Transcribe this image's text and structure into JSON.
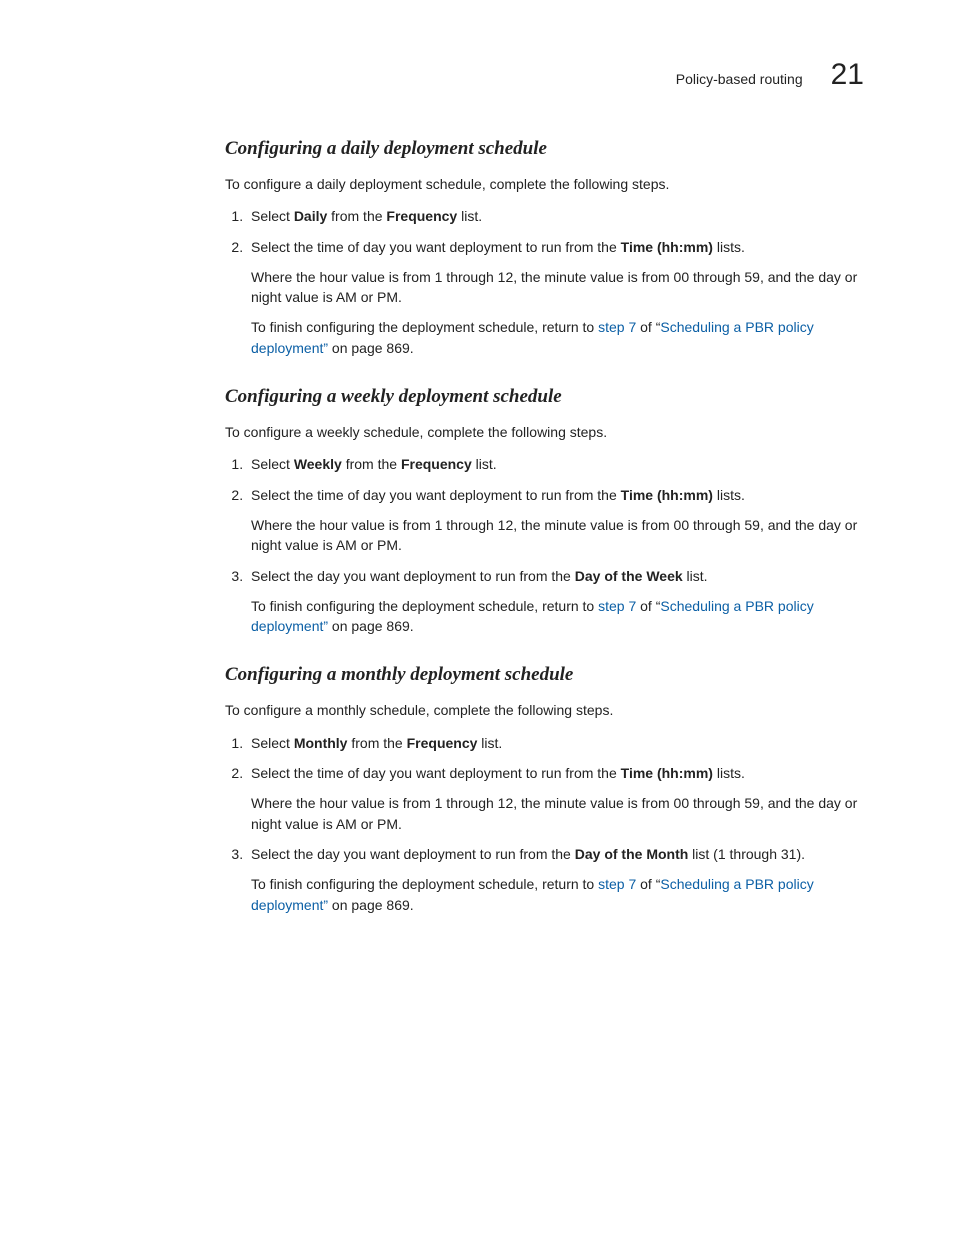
{
  "header": {
    "title": "Policy-based routing",
    "chapter": "21"
  },
  "link": {
    "step": "step 7",
    "of": " of ",
    "quote_open": "“",
    "title": "Scheduling a PBR policy deployment”",
    "after": " on page 869."
  },
  "sections": [
    {
      "heading": "Configuring a daily deployment schedule",
      "intro": "To configure a daily deployment schedule, complete the following steps.",
      "steps": [
        {
          "parts": [
            "Select ",
            "Daily",
            " from the ",
            "Frequency",
            " list."
          ]
        },
        {
          "parts": [
            "Select the time of day you want deployment to run from the ",
            "Time (hh:mm)",
            " lists."
          ],
          "sub1": "Where the hour value is from 1 through 12, the minute value is from 00 through 59, and the day or night value is AM or PM.",
          "sub2_prefix": "To finish configuring the deployment schedule, return to "
        }
      ]
    },
    {
      "heading": "Configuring a weekly deployment schedule",
      "intro": "To configure a weekly schedule, complete the following steps.",
      "steps": [
        {
          "parts": [
            "Select ",
            "Weekly",
            " from the ",
            "Frequency",
            " list."
          ]
        },
        {
          "parts": [
            "Select the time of day you want deployment to run from the ",
            "Time (hh:mm)",
            " lists."
          ],
          "sub1": "Where the hour value is from 1 through 12, the minute value is from 00 through 59, and the day or night value is AM or PM."
        },
        {
          "parts": [
            "Select the day you want deployment to run from the ",
            "Day of the Week",
            " list."
          ],
          "sub2_prefix": "To finish configuring the deployment schedule, return to "
        }
      ]
    },
    {
      "heading": "Configuring a monthly deployment schedule",
      "intro": "To configure a monthly schedule, complete the following steps.",
      "steps": [
        {
          "parts": [
            "Select ",
            "Monthly",
            " from the ",
            "Frequency",
            " list."
          ]
        },
        {
          "parts": [
            "Select the time of day you want deployment to run from the ",
            "Time (hh:mm)",
            " lists."
          ],
          "sub1": "Where the hour value is from 1 through 12, the minute value is from 00 through 59, and the day or night value is AM or PM."
        },
        {
          "parts": [
            "Select the day you want deployment to run from the ",
            "Day of the Month",
            " list (1 through 31)."
          ],
          "sub2_prefix": "To finish configuring the deployment schedule, return to "
        }
      ]
    }
  ]
}
